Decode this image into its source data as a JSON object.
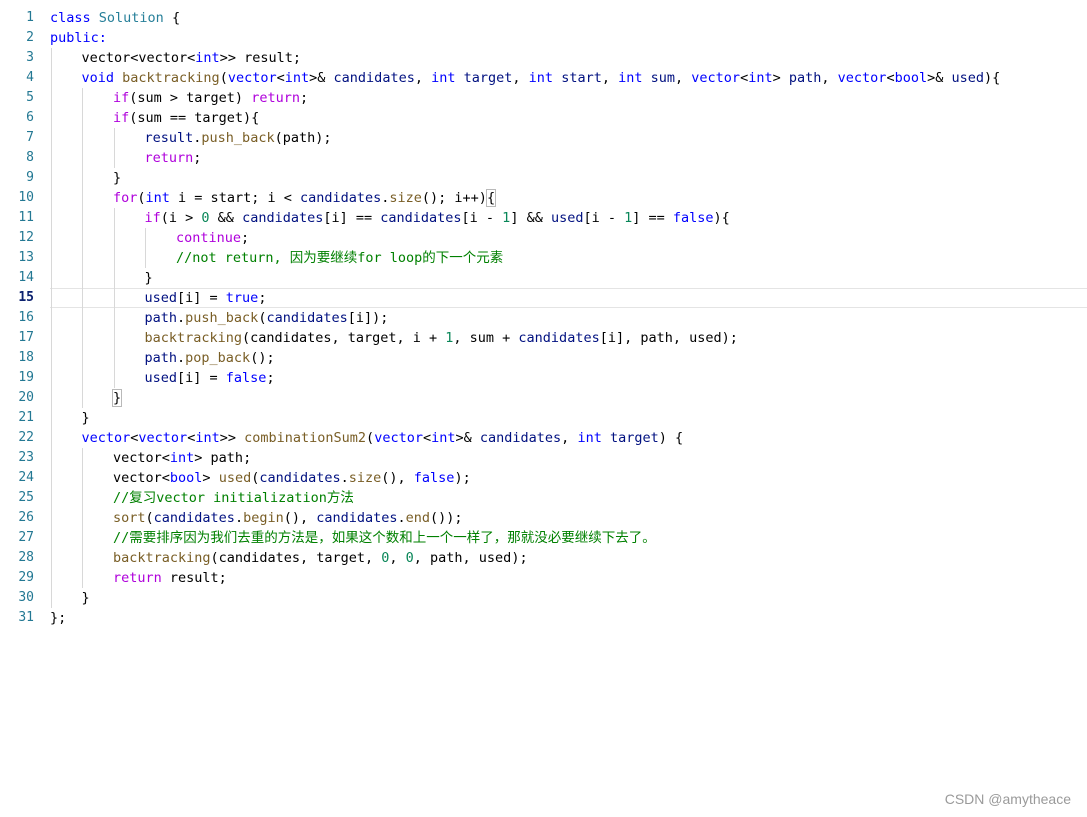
{
  "editor": {
    "current_line": 15,
    "lines": [
      {
        "n": "1",
        "indent": 0,
        "tokens": [
          [
            "kw",
            "class"
          ],
          [
            "p",
            " "
          ],
          [
            "cls",
            "Solution"
          ],
          [
            "p",
            " {"
          ]
        ]
      },
      {
        "n": "2",
        "indent": 0,
        "tokens": [
          [
            "kw",
            "public:"
          ]
        ]
      },
      {
        "n": "3",
        "indent": 1,
        "tokens": [
          [
            "p",
            "vector<vector<"
          ],
          [
            "ty",
            "int"
          ],
          [
            "p",
            ">> result;"
          ]
        ]
      },
      {
        "n": "4",
        "indent": 1,
        "tokens": [
          [
            "ty",
            "void"
          ],
          [
            "p",
            " "
          ],
          [
            "fn",
            "backtracking"
          ],
          [
            "p",
            "("
          ],
          [
            "ty",
            "vector"
          ],
          [
            "p",
            "<"
          ],
          [
            "ty",
            "int"
          ],
          [
            "p",
            ">& "
          ],
          [
            "var",
            "candidates"
          ],
          [
            "p",
            ", "
          ],
          [
            "ty",
            "int"
          ],
          [
            "p",
            " "
          ],
          [
            "var",
            "target"
          ],
          [
            "p",
            ", "
          ],
          [
            "ty",
            "int"
          ],
          [
            "p",
            " "
          ],
          [
            "var",
            "start"
          ],
          [
            "p",
            ", "
          ],
          [
            "ty",
            "int"
          ],
          [
            "p",
            " "
          ],
          [
            "var",
            "sum"
          ],
          [
            "p",
            ", "
          ],
          [
            "ty",
            "vector"
          ],
          [
            "p",
            "<"
          ],
          [
            "ty",
            "int"
          ],
          [
            "p",
            "> "
          ],
          [
            "var",
            "path"
          ],
          [
            "p",
            ", "
          ],
          [
            "ty",
            "vector"
          ],
          [
            "p",
            "<"
          ],
          [
            "ty",
            "bool"
          ],
          [
            "p",
            ">& "
          ],
          [
            "var",
            "used"
          ],
          [
            "p",
            "){"
          ]
        ]
      },
      {
        "n": "5",
        "indent": 2,
        "tokens": [
          [
            "ctl",
            "if"
          ],
          [
            "p",
            "(sum > target) "
          ],
          [
            "ctl",
            "return"
          ],
          [
            "p",
            ";"
          ]
        ]
      },
      {
        "n": "6",
        "indent": 2,
        "tokens": [
          [
            "ctl",
            "if"
          ],
          [
            "p",
            "(sum == target){"
          ]
        ]
      },
      {
        "n": "7",
        "indent": 3,
        "tokens": [
          [
            "var",
            "result"
          ],
          [
            "p",
            "."
          ],
          [
            "fn",
            "push_back"
          ],
          [
            "p",
            "(path);"
          ]
        ]
      },
      {
        "n": "8",
        "indent": 3,
        "tokens": [
          [
            "ctl",
            "return"
          ],
          [
            "p",
            ";"
          ]
        ]
      },
      {
        "n": "9",
        "indent": 2,
        "tokens": [
          [
            "p",
            "}"
          ]
        ]
      },
      {
        "n": "10",
        "indent": 2,
        "tokens": [
          [
            "ctl",
            "for"
          ],
          [
            "p",
            "("
          ],
          [
            "ty",
            "int"
          ],
          [
            "p",
            " i = start; i < "
          ],
          [
            "var",
            "candidates"
          ],
          [
            "p",
            "."
          ],
          [
            "fn",
            "size"
          ],
          [
            "p",
            "(); i++)"
          ],
          [
            "br",
            "{"
          ]
        ]
      },
      {
        "n": "11",
        "indent": 3,
        "tokens": [
          [
            "ctl",
            "if"
          ],
          [
            "p",
            "(i > "
          ],
          [
            "num",
            "0"
          ],
          [
            "p",
            " && "
          ],
          [
            "var",
            "candidates"
          ],
          [
            "p",
            "[i] == "
          ],
          [
            "var",
            "candidates"
          ],
          [
            "p",
            "[i - "
          ],
          [
            "num",
            "1"
          ],
          [
            "p",
            "] && "
          ],
          [
            "var",
            "used"
          ],
          [
            "p",
            "[i - "
          ],
          [
            "num",
            "1"
          ],
          [
            "p",
            "] == "
          ],
          [
            "kw",
            "false"
          ],
          [
            "p",
            "){"
          ]
        ]
      },
      {
        "n": "12",
        "indent": 4,
        "tokens": [
          [
            "ctl",
            "continue"
          ],
          [
            "p",
            ";"
          ]
        ]
      },
      {
        "n": "13",
        "indent": 4,
        "tokens": [
          [
            "cmt",
            "//not return, 因为要继续for loop的下一个元素"
          ]
        ]
      },
      {
        "n": "14",
        "indent": 3,
        "tokens": [
          [
            "p",
            "}"
          ]
        ]
      },
      {
        "n": "15",
        "indent": 3,
        "tokens": [
          [
            "var",
            "used"
          ],
          [
            "p",
            "[i] = "
          ],
          [
            "kw",
            "true"
          ],
          [
            "p",
            ";"
          ]
        ]
      },
      {
        "n": "16",
        "indent": 3,
        "tokens": [
          [
            "var",
            "path"
          ],
          [
            "p",
            "."
          ],
          [
            "fn",
            "push_back"
          ],
          [
            "p",
            "("
          ],
          [
            "var",
            "candidates"
          ],
          [
            "p",
            "[i]);"
          ]
        ]
      },
      {
        "n": "17",
        "indent": 3,
        "tokens": [
          [
            "fn",
            "backtracking"
          ],
          [
            "p",
            "(candidates, target, i + "
          ],
          [
            "num",
            "1"
          ],
          [
            "p",
            ", sum + "
          ],
          [
            "var",
            "candidates"
          ],
          [
            "p",
            "[i], path, used);"
          ]
        ]
      },
      {
        "n": "18",
        "indent": 3,
        "tokens": [
          [
            "var",
            "path"
          ],
          [
            "p",
            "."
          ],
          [
            "fn",
            "pop_back"
          ],
          [
            "p",
            "();"
          ]
        ]
      },
      {
        "n": "19",
        "indent": 3,
        "tokens": [
          [
            "var",
            "used"
          ],
          [
            "p",
            "[i] = "
          ],
          [
            "kw",
            "false"
          ],
          [
            "p",
            ";"
          ]
        ]
      },
      {
        "n": "20",
        "indent": 2,
        "tokens": [
          [
            "br",
            "}"
          ]
        ]
      },
      {
        "n": "21",
        "indent": 1,
        "tokens": [
          [
            "p",
            "}"
          ]
        ]
      },
      {
        "n": "22",
        "indent": 1,
        "tokens": [
          [
            "ty",
            "vector"
          ],
          [
            "p",
            "<"
          ],
          [
            "ty",
            "vector"
          ],
          [
            "p",
            "<"
          ],
          [
            "ty",
            "int"
          ],
          [
            "p",
            ">> "
          ],
          [
            "fn",
            "combinationSum2"
          ],
          [
            "p",
            "("
          ],
          [
            "ty",
            "vector"
          ],
          [
            "p",
            "<"
          ],
          [
            "ty",
            "int"
          ],
          [
            "p",
            ">& "
          ],
          [
            "var",
            "candidates"
          ],
          [
            "p",
            ", "
          ],
          [
            "ty",
            "int"
          ],
          [
            "p",
            " "
          ],
          [
            "var",
            "target"
          ],
          [
            "p",
            ") {"
          ]
        ]
      },
      {
        "n": "23",
        "indent": 2,
        "tokens": [
          [
            "p",
            "vector<"
          ],
          [
            "ty",
            "int"
          ],
          [
            "p",
            "> path;"
          ]
        ]
      },
      {
        "n": "24",
        "indent": 2,
        "tokens": [
          [
            "p",
            "vector<"
          ],
          [
            "ty",
            "bool"
          ],
          [
            "p",
            "> "
          ],
          [
            "fn",
            "used"
          ],
          [
            "p",
            "("
          ],
          [
            "var",
            "candidates"
          ],
          [
            "p",
            "."
          ],
          [
            "fn",
            "size"
          ],
          [
            "p",
            "(), "
          ],
          [
            "kw",
            "false"
          ],
          [
            "p",
            ");"
          ]
        ]
      },
      {
        "n": "25",
        "indent": 2,
        "tokens": [
          [
            "cmt",
            "//复习vector initialization方法"
          ]
        ]
      },
      {
        "n": "26",
        "indent": 2,
        "tokens": [
          [
            "fn",
            "sort"
          ],
          [
            "p",
            "("
          ],
          [
            "var",
            "candidates"
          ],
          [
            "p",
            "."
          ],
          [
            "fn",
            "begin"
          ],
          [
            "p",
            "(), "
          ],
          [
            "var",
            "candidates"
          ],
          [
            "p",
            "."
          ],
          [
            "fn",
            "end"
          ],
          [
            "p",
            "());"
          ]
        ]
      },
      {
        "n": "27",
        "indent": 2,
        "tokens": [
          [
            "cmt",
            "//需要排序因为我们去重的方法是，如果这个数和上一个一样了，那就没必要继续下去了。"
          ]
        ]
      },
      {
        "n": "28",
        "indent": 2,
        "tokens": [
          [
            "fn",
            "backtracking"
          ],
          [
            "p",
            "(candidates, target, "
          ],
          [
            "num",
            "0"
          ],
          [
            "p",
            ", "
          ],
          [
            "num",
            "0"
          ],
          [
            "p",
            ", path, used);"
          ]
        ]
      },
      {
        "n": "29",
        "indent": 2,
        "tokens": [
          [
            "ctl",
            "return"
          ],
          [
            "p",
            " result;"
          ]
        ]
      },
      {
        "n": "30",
        "indent": 1,
        "tokens": [
          [
            "p",
            "}"
          ]
        ]
      },
      {
        "n": "31",
        "indent": 0,
        "tokens": [
          [
            "p",
            "};"
          ]
        ]
      }
    ]
  },
  "watermark": "CSDN @amytheace"
}
